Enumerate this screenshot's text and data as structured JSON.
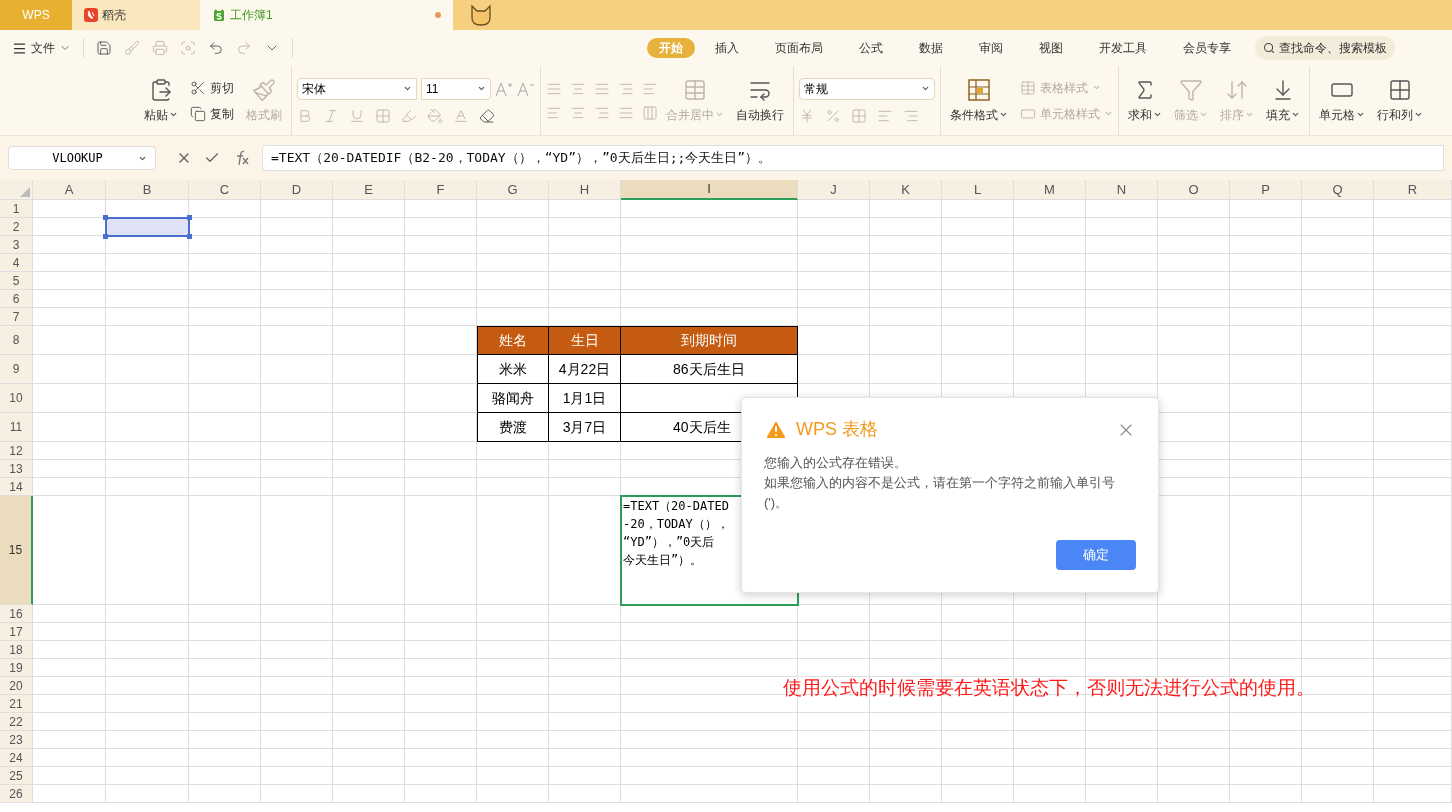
{
  "tabs": [
    {
      "label": "WPS",
      "kind": "home",
      "selected": false
    },
    {
      "label": "稻壳",
      "kind": "docer",
      "selected": false
    },
    {
      "label": "工作簿1",
      "kind": "sheet",
      "selected": true,
      "modified": true
    }
  ],
  "file_menu": "文件",
  "ribbon_tabs": [
    {
      "label": "开始",
      "selected": true
    },
    {
      "label": "插入",
      "selected": false
    },
    {
      "label": "页面布局",
      "selected": false
    },
    {
      "label": "公式",
      "selected": false
    },
    {
      "label": "数据",
      "selected": false
    },
    {
      "label": "审阅",
      "selected": false
    },
    {
      "label": "视图",
      "selected": false
    },
    {
      "label": "开发工具",
      "selected": false
    },
    {
      "label": "会员专享",
      "selected": false
    }
  ],
  "search": {
    "placeholder": "查找命令、搜索模板"
  },
  "ribbon": {
    "clipboard": {
      "paste": {
        "label": "粘贴",
        "disabled": false
      },
      "cut": {
        "label": "剪切",
        "disabled": false
      },
      "copy": {
        "label": "复制",
        "disabled": false
      },
      "format_painter": {
        "label": "格式刷",
        "disabled": true
      }
    },
    "font": {
      "name": "宋体",
      "size": "11"
    },
    "alignment": {
      "merge": {
        "label": "合并居中",
        "disabled": true
      },
      "wrap": {
        "label": "自动换行",
        "disabled": false
      }
    },
    "number": {
      "format": "常规"
    },
    "styles": {
      "conditional": {
        "label": "条件格式",
        "disabled": false
      },
      "table_style": {
        "label": "表格样式",
        "disabled": true
      },
      "cell_style": {
        "label": "单元格样式",
        "disabled": true
      }
    },
    "editing": [
      {
        "label": "求和",
        "disabled": false
      },
      {
        "label": "筛选",
        "disabled": true
      },
      {
        "label": "排序",
        "disabled": true
      },
      {
        "label": "填充",
        "disabled": false
      }
    ],
    "cells": [
      {
        "label": "单元格",
        "disabled": false
      },
      {
        "label": "行和列",
        "disabled": false
      }
    ]
  },
  "formula_bar": {
    "name_box": "VLOOKUP",
    "formula": "=TEXT（20-DATEDIF（B2-20，TODAY（），“YD”），”0天后生日;;今天生日”）。"
  },
  "sheet": {
    "columns": [
      {
        "label": "A",
        "selected": false,
        "highlighted": false
      },
      {
        "label": "B",
        "selected": false,
        "highlighted": true
      },
      {
        "label": "C",
        "selected": false,
        "highlighted": false
      },
      {
        "label": "D",
        "selected": false,
        "highlighted": false
      },
      {
        "label": "E",
        "selected": false,
        "highlighted": false
      },
      {
        "label": "F",
        "selected": false,
        "highlighted": false
      },
      {
        "label": "G",
        "selected": false,
        "highlighted": false
      },
      {
        "label": "H",
        "selected": false,
        "highlighted": false
      },
      {
        "label": "I",
        "selected": true,
        "highlighted": false
      },
      {
        "label": "J",
        "selected": false,
        "highlighted": false
      },
      {
        "label": "K",
        "selected": false,
        "highlighted": false
      },
      {
        "label": "L",
        "selected": false,
        "highlighted": false
      },
      {
        "label": "M",
        "selected": false,
        "highlighted": false
      },
      {
        "label": "N",
        "selected": false,
        "highlighted": false
      },
      {
        "label": "O",
        "selected": false,
        "highlighted": false
      },
      {
        "label": "P",
        "selected": false,
        "highlighted": false
      },
      {
        "label": "Q",
        "selected": false,
        "highlighted": false
      },
      {
        "label": "R",
        "selected": false,
        "highlighted": false
      }
    ],
    "rows": [
      {
        "label": "1",
        "selected": false,
        "highlighted": false
      },
      {
        "label": "2",
        "selected": false,
        "highlighted": true
      },
      {
        "label": "3",
        "selected": false,
        "highlighted": false
      },
      {
        "label": "4",
        "selected": false,
        "highlighted": false
      },
      {
        "label": "5",
        "selected": false,
        "highlighted": false
      },
      {
        "label": "6",
        "selected": false,
        "highlighted": false
      },
      {
        "label": "7",
        "selected": false,
        "highlighted": false
      },
      {
        "label": "8",
        "selected": false,
        "highlighted": false
      },
      {
        "label": "9",
        "selected": false,
        "highlighted": false
      },
      {
        "label": "10",
        "selected": false,
        "highlighted": false
      },
      {
        "label": "11",
        "selected": false,
        "highlighted": false
      },
      {
        "label": "12",
        "selected": false,
        "highlighted": false
      },
      {
        "label": "13",
        "selected": false,
        "highlighted": false
      },
      {
        "label": "14",
        "selected": false,
        "highlighted": false
      },
      {
        "label": "15",
        "selected": true,
        "highlighted": false
      },
      {
        "label": "16",
        "selected": false,
        "highlighted": false
      },
      {
        "label": "17",
        "selected": false,
        "highlighted": false
      },
      {
        "label": "18",
        "selected": false,
        "highlighted": false
      },
      {
        "label": "19",
        "selected": false,
        "highlighted": false
      },
      {
        "label": "20",
        "selected": false,
        "highlighted": false
      },
      {
        "label": "21",
        "selected": false,
        "highlighted": false
      },
      {
        "label": "22",
        "selected": false,
        "highlighted": false
      },
      {
        "label": "23",
        "selected": false,
        "highlighted": false
      },
      {
        "label": "24",
        "selected": false,
        "highlighted": false
      },
      {
        "label": "25",
        "selected": false,
        "highlighted": false
      },
      {
        "label": "26",
        "selected": false,
        "highlighted": false
      }
    ],
    "table": {
      "header": [
        "姓名",
        "生日",
        "到期时间"
      ],
      "rows": [
        [
          "米米",
          "4月22日",
          "86天后生日"
        ],
        [
          "骆闻舟",
          "1月1日"
        ],
        [
          "费渡",
          "3月7日",
          "40天后生"
        ]
      ]
    },
    "cell_editor": {
      "lines": [
        "=TEXT（20-DATED",
        "-20，TODAY（），",
        "“YD”），”0天后",
        "今天生日”）。"
      ]
    }
  },
  "dialog": {
    "title": "WPS 表格",
    "message": [
      "您输入的公式存在错误。",
      "如果您输入的内容不是公式，请在第一个字符之前输入单引号(')。"
    ],
    "ok": "确定"
  },
  "note": "使用公式的时候需要在英语状态下，否则无法进行公式的使用。"
}
